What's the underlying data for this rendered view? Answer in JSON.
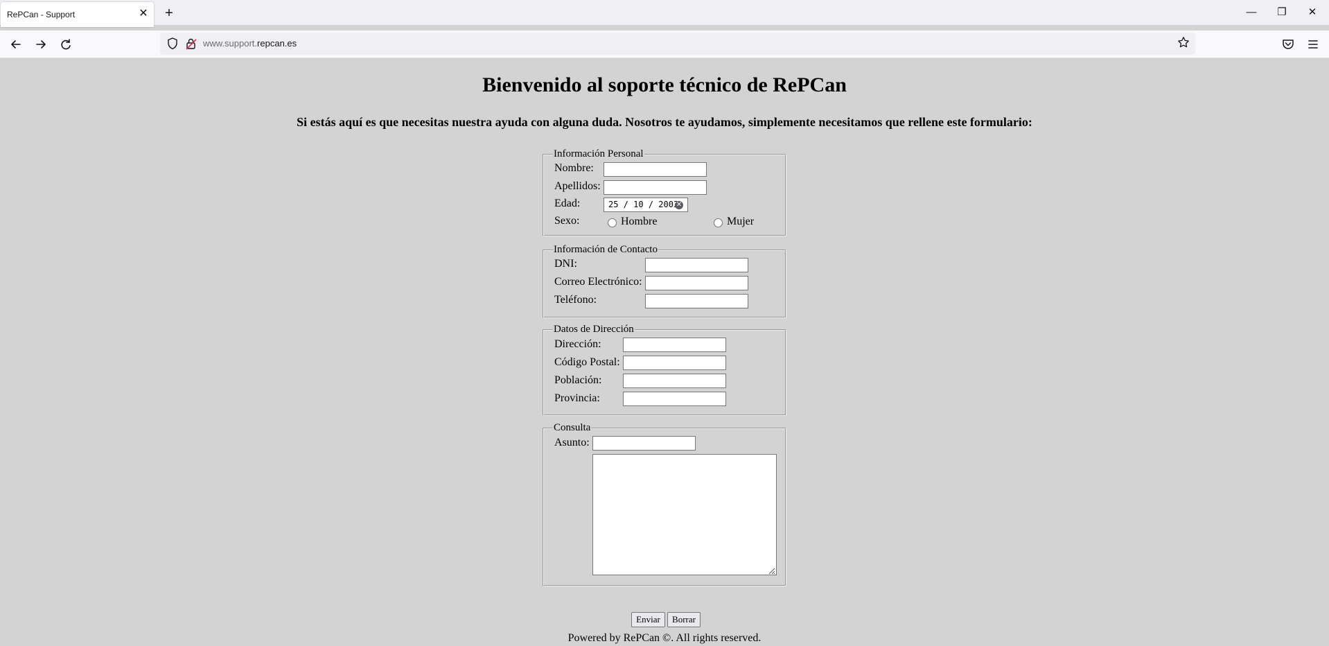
{
  "browser": {
    "tab_title": "RePCan - Support",
    "tab_close": "✕",
    "new_tab": "+",
    "url_prefix": "www.support.",
    "url_domain": "repcan.es",
    "win_minimize": "—",
    "win_restore": "❐",
    "win_close": "✕"
  },
  "page": {
    "title": "Bienvenido al soporte técnico de RePCan",
    "intro": "Si estás aquí es que necesitas nuestra ayuda con alguna duda. Nosotros te ayudamos, simplemente necesitamos que rellene este formulario:"
  },
  "personal": {
    "legend": "Información Personal",
    "nombre_label": "Nombre:",
    "apellidos_label": "Apellidos:",
    "edad_label": "Edad:",
    "edad_value": "25 / 10 / 2003",
    "sexo_label": "Sexo:",
    "hombre_label": "Hombre",
    "mujer_label": "Mujer"
  },
  "contacto": {
    "legend": "Información de Contacto",
    "dni_label": "DNI:",
    "correo_label": "Correo Electrónico:",
    "telefono_label": "Teléfono:"
  },
  "direccion": {
    "legend": "Datos de Dirección",
    "direccion_label": "Dirección:",
    "cp_label": "Código Postal:",
    "poblacion_label": "Población:",
    "provincia_label": "Provincia:"
  },
  "consulta": {
    "legend": "Consulta",
    "asunto_label": "Asunto:"
  },
  "buttons": {
    "enviar": "Enviar",
    "borrar": "Borrar"
  },
  "footer": "Powered by RePCan ©. All rights reserved."
}
